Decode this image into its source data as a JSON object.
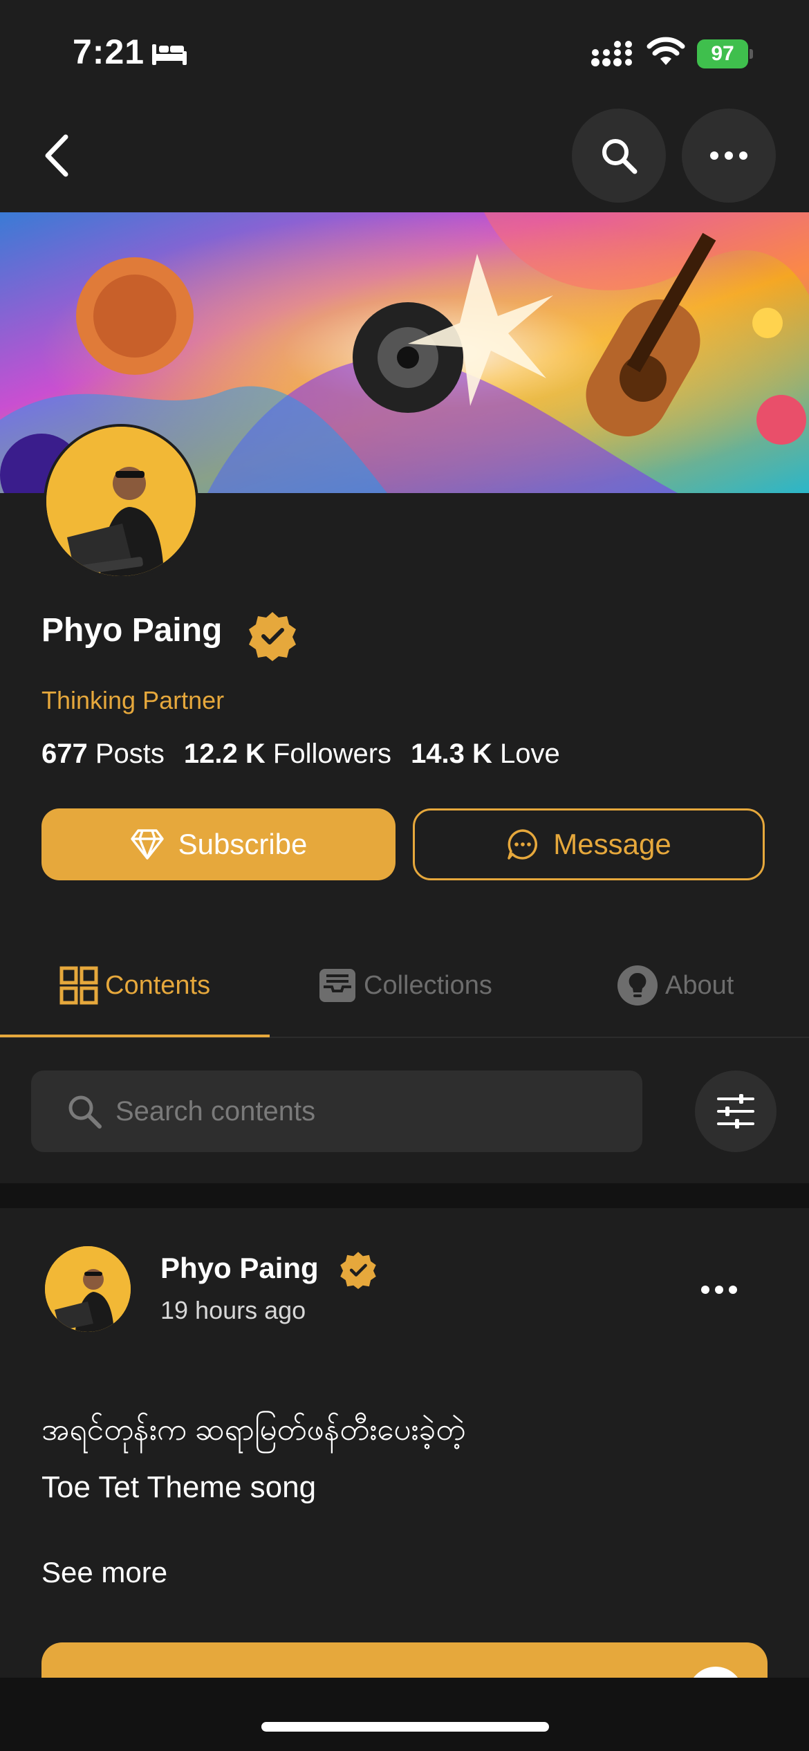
{
  "status_bar": {
    "time": "7:21",
    "battery": "97"
  },
  "profile": {
    "name": "Phyo Paing",
    "tagline": "Thinking Partner",
    "stats": [
      {
        "value": "677",
        "label": "Posts"
      },
      {
        "value": "12.2 K",
        "label": "Followers"
      },
      {
        "value": "14.3 K",
        "label": "Love"
      }
    ],
    "subscribe_label": "Subscribe",
    "message_label": "Message"
  },
  "tabs": [
    {
      "label": "Contents",
      "icon": "grid-icon",
      "active": true
    },
    {
      "label": "Collections",
      "icon": "tray-icon",
      "active": false
    },
    {
      "label": "About",
      "icon": "bulb-icon",
      "active": false
    }
  ],
  "search": {
    "placeholder": "Search contents"
  },
  "post": {
    "author": "Phyo Paing",
    "time": "19 hours ago",
    "line1": "အရင်တုန်းက ဆရာမြတ်ဖန်တီးပေးခဲ့တဲ့",
    "line2": "Toe Tet Theme song",
    "see_more": "See more"
  },
  "colors": {
    "accent": "#e6a83c",
    "background": "#1e1e1e",
    "battery": "#3fbf4d"
  }
}
